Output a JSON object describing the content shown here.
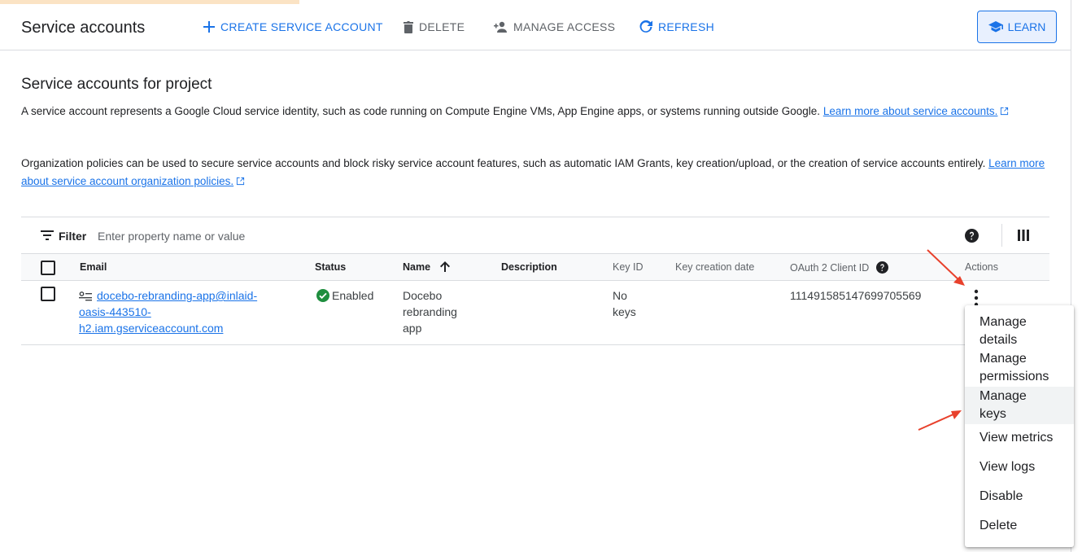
{
  "toolbar": {
    "title": "Service accounts",
    "create": "CREATE SERVICE ACCOUNT",
    "delete": "DELETE",
    "manage_access": "MANAGE ACCESS",
    "refresh": "REFRESH",
    "learn": "LEARN"
  },
  "section": {
    "title": "Service accounts for project",
    "para1_text": "A service account represents a Google Cloud service identity, such as code running on Compute Engine VMs, App Engine apps, or systems running outside Google. ",
    "para1_link": "Learn more about service accounts.",
    "para2_text": "Organization policies can be used to secure service accounts and block risky service account features, such as automatic IAM Grants, key creation/upload, or the creation of service accounts entirely. ",
    "para2_link": "Learn more about service account organization policies."
  },
  "filter": {
    "label": "Filter",
    "placeholder": "Enter property name or value"
  },
  "table": {
    "headers": {
      "email": "Email",
      "status": "Status",
      "name": "Name",
      "description": "Description",
      "key_id": "Key ID",
      "key_creation_date": "Key creation date",
      "oauth_client_id": "OAuth 2 Client ID",
      "actions": "Actions"
    },
    "rows": [
      {
        "email_line1": "docebo-rebranding-app@inlaid-",
        "email_line2": "oasis-443510-",
        "email_line3": "h2.iam.gserviceaccount.com",
        "status": "Enabled",
        "name_line1": "Docebo",
        "name_line2": "rebranding",
        "name_line3": "app",
        "key_id_line1": "No",
        "key_id_line2": "keys",
        "oauth_client_id": "111491585147699705569"
      }
    ]
  },
  "menu": {
    "items": [
      {
        "line1": "Manage",
        "line2": "details"
      },
      {
        "line1": "Manage",
        "line2": "permissions"
      },
      {
        "line1": "Manage",
        "line2": "keys"
      },
      {
        "line1": "View metrics"
      },
      {
        "line1": "View logs"
      },
      {
        "line1": "Disable"
      },
      {
        "line1": "Delete"
      }
    ]
  },
  "colors": {
    "accent": "#1a73e8",
    "status_ok": "#1e8e3e",
    "annotation_arrow": "#e8412c",
    "title_highlight": "#fbe3c4"
  },
  "icons": [
    "plus-icon",
    "trash-icon",
    "add-person-icon",
    "refresh-icon",
    "learn-cap-icon",
    "external-link-icon",
    "filter-icon",
    "help-icon",
    "columns-icon",
    "service-account-icon",
    "check-circle-icon",
    "sort-up-arrow-icon",
    "kebab-menu-icon"
  ]
}
